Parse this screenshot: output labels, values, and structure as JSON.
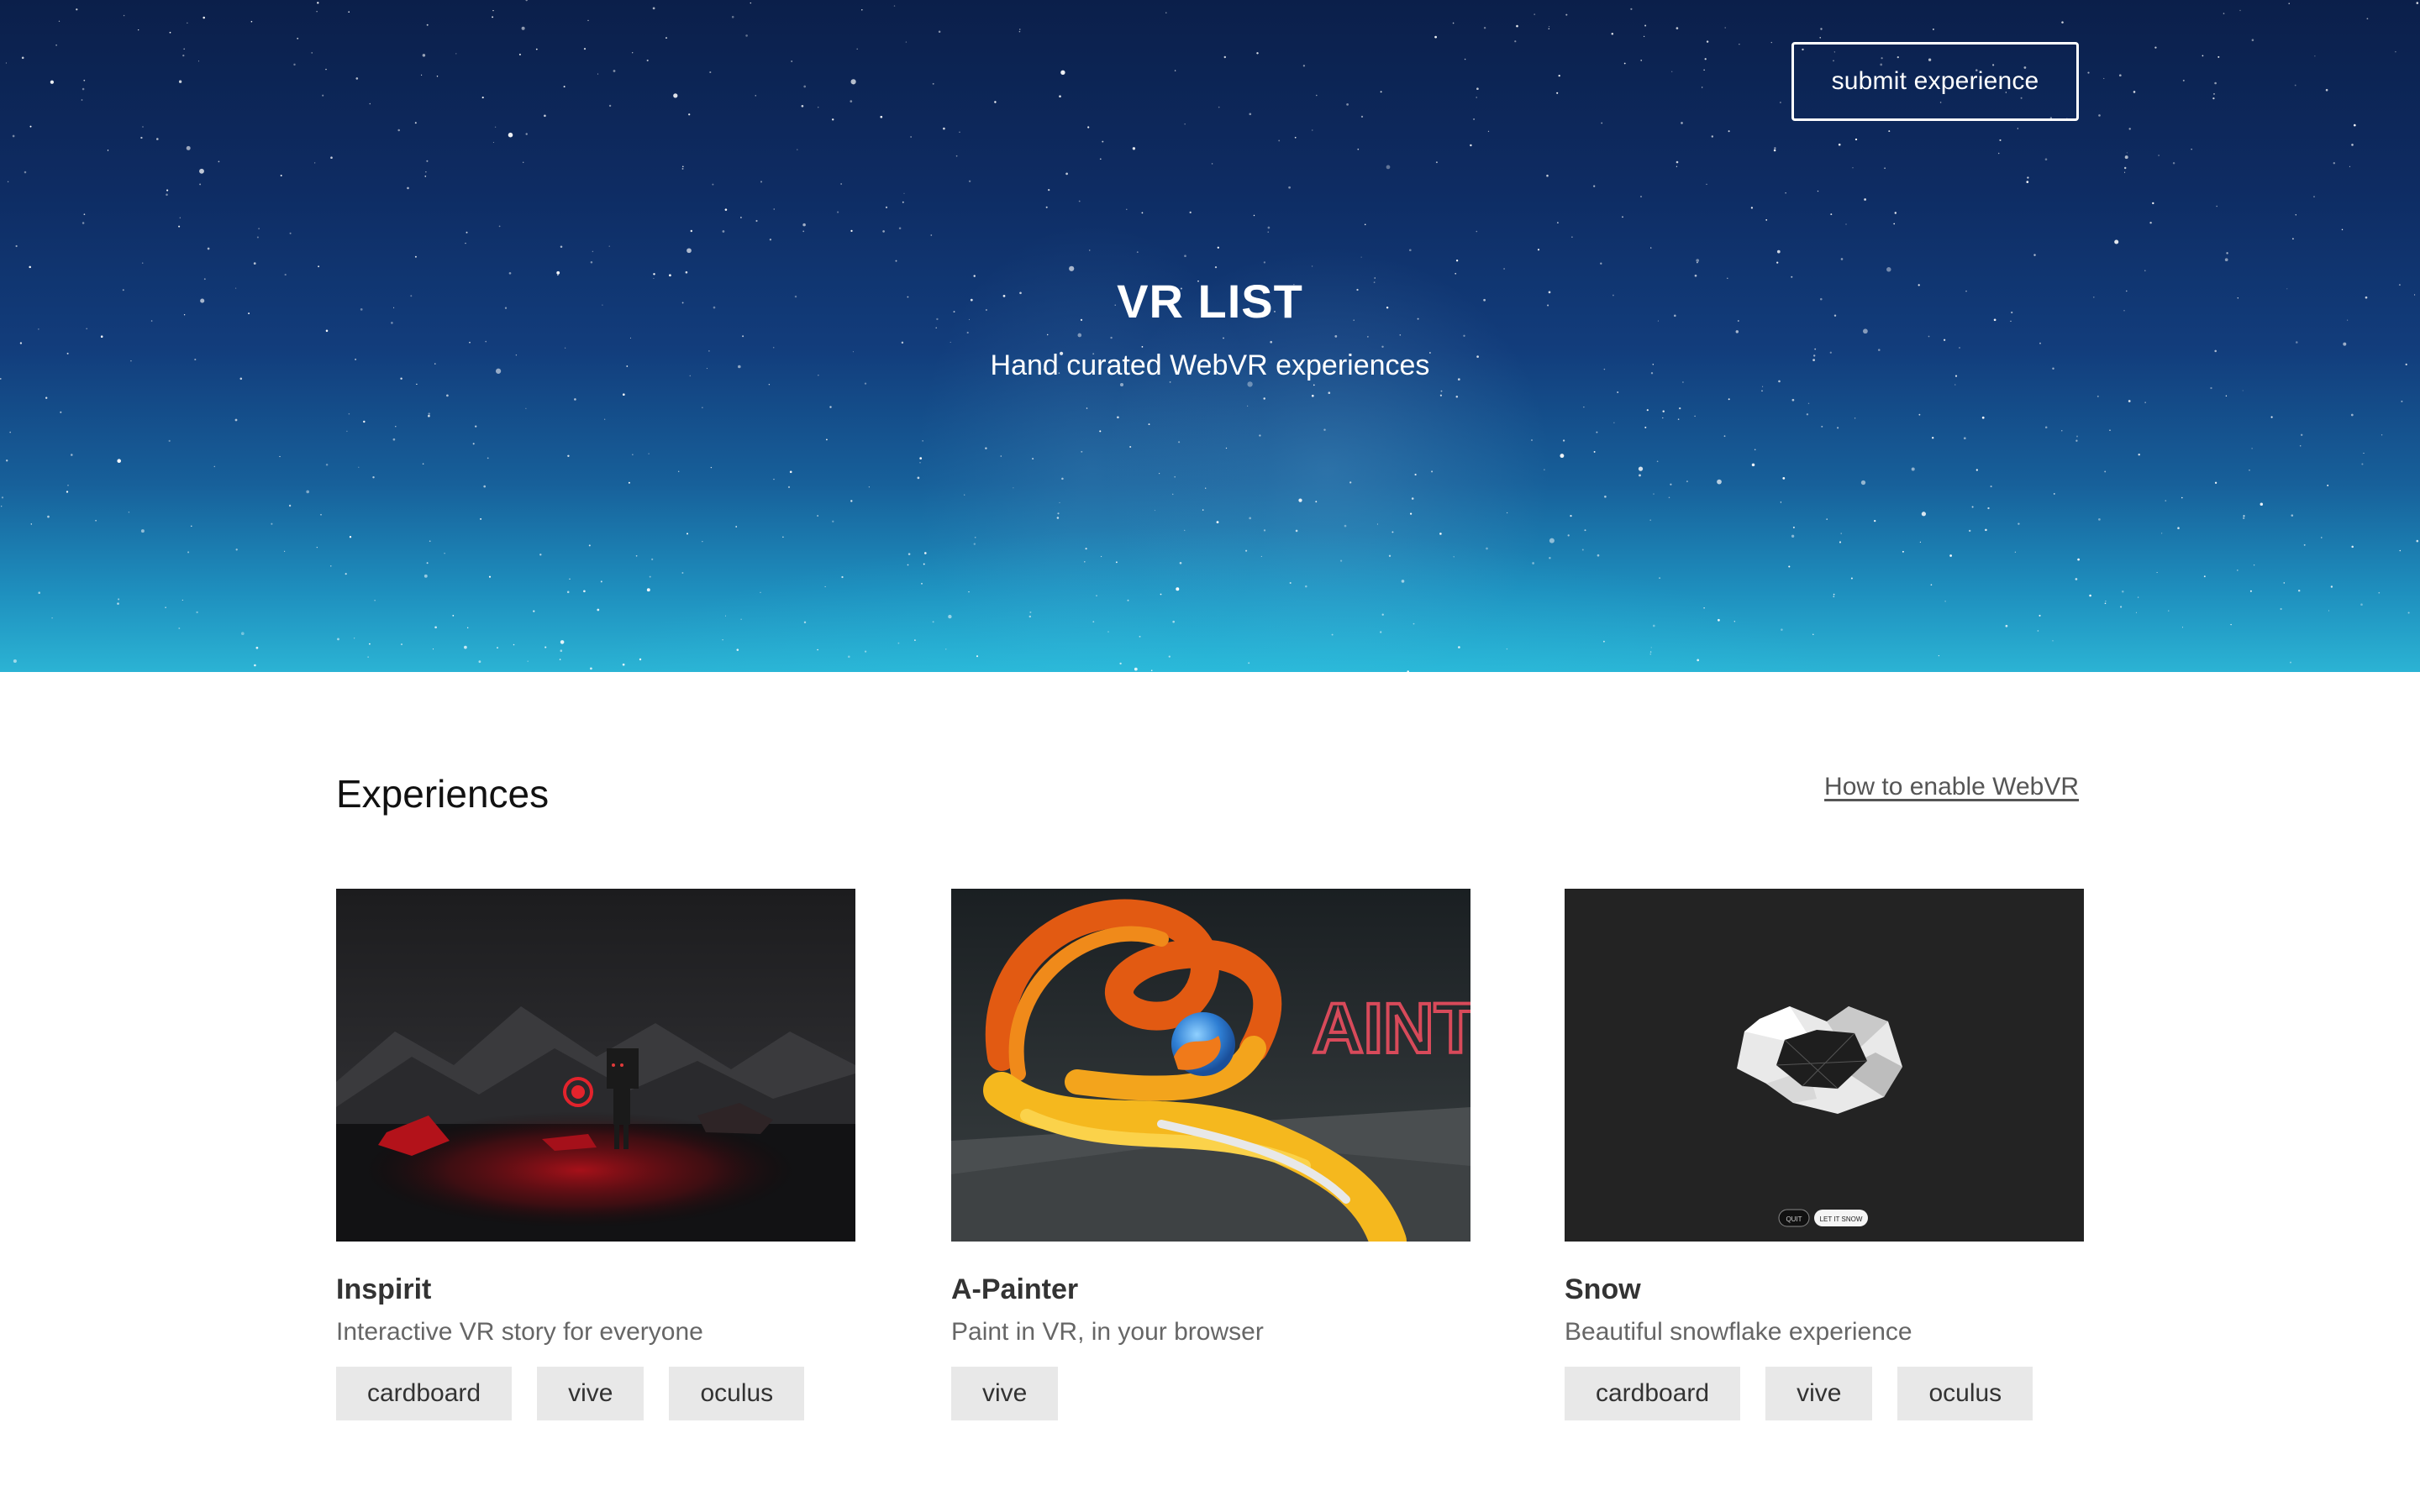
{
  "hero": {
    "submit_label": "submit experience",
    "title": "VR LIST",
    "subtitle": "Hand curated WebVR experiences"
  },
  "main": {
    "section_title": "Experiences",
    "help_link": "How to enable WebVR",
    "cards": [
      {
        "name": "Inspirit",
        "description": "Interactive VR story for everyone",
        "tags": [
          "cardboard",
          "vive",
          "oculus"
        ]
      },
      {
        "name": "A-Painter",
        "description": "Paint in VR, in your browser",
        "tags": [
          "vive"
        ]
      },
      {
        "name": "Snow",
        "description": "Beautiful snowflake experience",
        "tags": [
          "cardboard",
          "vive",
          "oculus"
        ],
        "thumbnail_buttons": [
          "QUIT",
          "LET IT SNOW"
        ]
      }
    ]
  },
  "colors": {
    "hero_top": "#0b1f4a",
    "hero_bottom": "#2bb3d4",
    "tag_bg": "#e8e8e8",
    "text_dark": "#333333",
    "text_muted": "#666666"
  }
}
